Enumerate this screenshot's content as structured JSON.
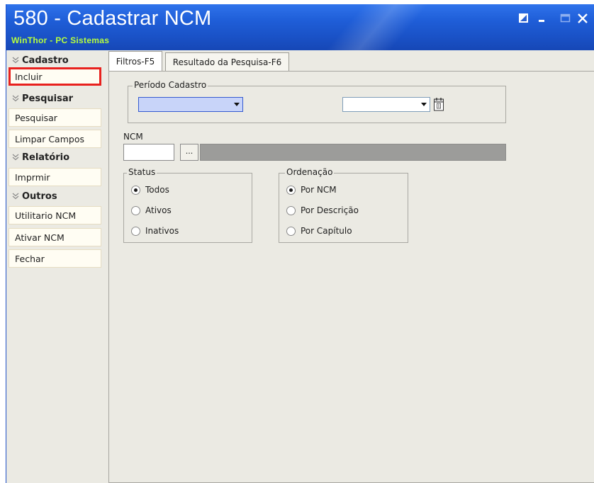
{
  "window": {
    "title": "580 - Cadastrar  NCM",
    "subtitle": "WinThor - PC Sistemas"
  },
  "sidebar": {
    "groups": [
      {
        "label": "Cadastro",
        "items": [
          {
            "label": "Incluir",
            "selected": true
          }
        ]
      },
      {
        "label": "Pesquisar",
        "items": [
          {
            "label": "Pesquisar"
          },
          {
            "label": "Limpar Campos"
          }
        ]
      },
      {
        "label": "Relatório",
        "items": [
          {
            "label": "Imprmir"
          }
        ]
      },
      {
        "label": "Outros",
        "items": [
          {
            "label": "Utilitario NCM"
          },
          {
            "label": "Ativar NCM"
          },
          {
            "label": "Fechar"
          }
        ]
      }
    ]
  },
  "tabs": [
    {
      "label": "Filtros-F5",
      "active": true
    },
    {
      "label": "Resultado da Pesquisa-F6",
      "active": false
    }
  ],
  "filters": {
    "periodo": {
      "legend": "Período Cadastro",
      "start_value": "",
      "end_value": ""
    },
    "ncm": {
      "label": "NCM",
      "value": "",
      "lookup_label": "...",
      "description": ""
    },
    "status": {
      "legend": "Status",
      "options": [
        "Todos",
        "Ativos",
        "Inativos"
      ],
      "selected": "Todos"
    },
    "ordenacao": {
      "legend": "Ordenação",
      "options": [
        "Por NCM",
        "Por Descrição",
        "Por Capítulo"
      ],
      "selected": "Por NCM"
    }
  },
  "colors": {
    "title_bar": "#1f5ed8",
    "subtitle": "#b8ff3c",
    "highlight_border": "#e8211e"
  },
  "icons": {
    "calendar": "calendar-icon",
    "restore": "restore-icon",
    "minimize": "minimize-icon",
    "maximize": "maximize-icon",
    "close": "close-icon"
  }
}
